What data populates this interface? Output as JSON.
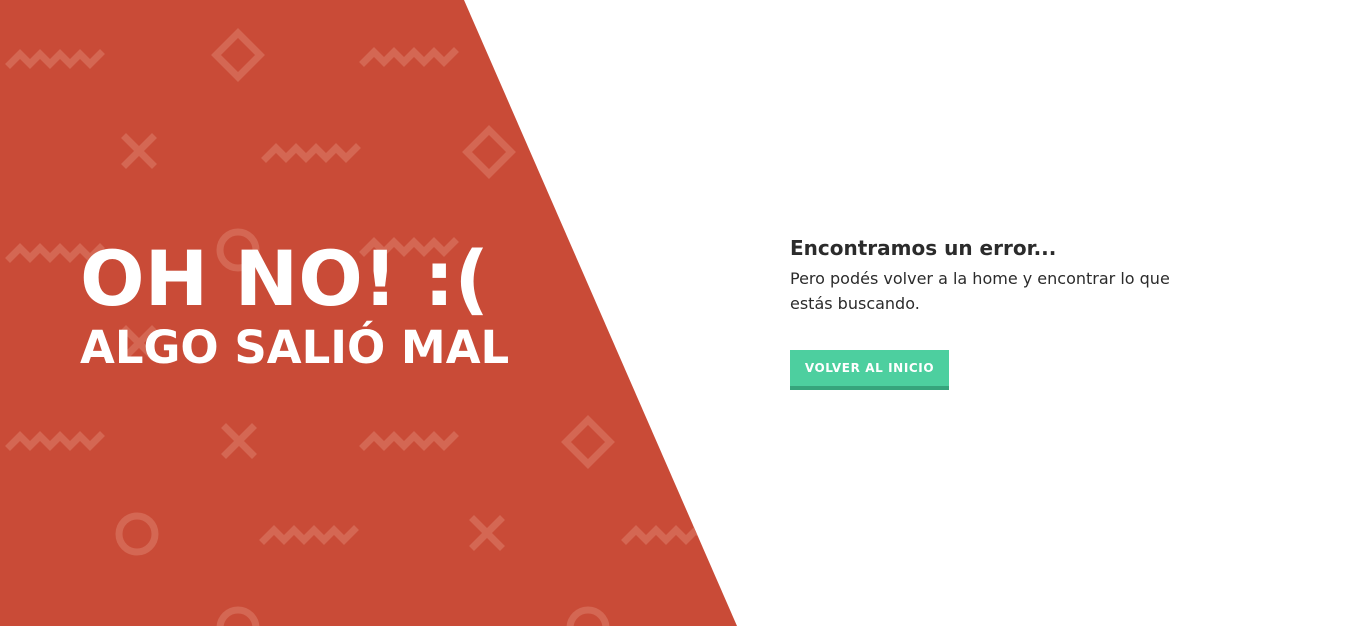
{
  "hero": {
    "title": "OH NO! :(",
    "subtitle": "ALGO SALIÓ MAL",
    "background_color": "#c94b37",
    "pattern_color": "#d46753"
  },
  "content": {
    "heading": "Encontramos un error...",
    "message": "Pero podés volver a la home y encontrar lo que estás buscando.",
    "button_label": "VOLVER AL INICIO",
    "button_color": "#4dcf9f"
  }
}
